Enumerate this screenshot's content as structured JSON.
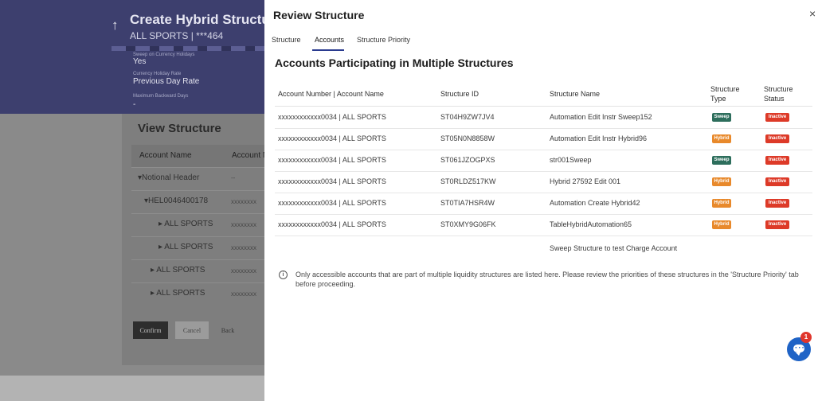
{
  "background": {
    "header": {
      "title": "Create Hybrid Structure",
      "subtitle": "ALL SPORTS | ***464",
      "fields": [
        {
          "label": "Sweep on Currency Holidays",
          "value": "Yes"
        },
        {
          "label": "Currency Holiday Rate",
          "value": "Previous Day Rate"
        },
        {
          "label": "Maximum Backward Days",
          "value": "-"
        }
      ]
    },
    "view_structure": {
      "title": "View Structure",
      "columns": [
        "Account Name",
        "Account N"
      ],
      "rows": [
        {
          "name": "▾Notional Header",
          "account": "--"
        },
        {
          "name": "▾HEL0046400178",
          "account": "xxxxxxxx"
        },
        {
          "name": "▸ ALL SPORTS",
          "account": "xxxxxxxx"
        },
        {
          "name": "▸ ALL SPORTS",
          "account": "xxxxxxxx"
        },
        {
          "name": "▸ ALL SPORTS",
          "account": "xxxxxxxx"
        },
        {
          "name": "▸ ALL SPORTS",
          "account": "xxxxxxxx"
        }
      ]
    },
    "buttons": {
      "confirm": "Confirm",
      "cancel": "Cancel",
      "back": "Back"
    }
  },
  "modal": {
    "title": "Review Structure",
    "close": "×",
    "tabs": [
      {
        "label": "Structure",
        "active": false
      },
      {
        "label": "Accounts",
        "active": true
      },
      {
        "label": "Structure Priority",
        "active": false
      }
    ],
    "heading": "Accounts Participating in Multiple Structures",
    "columns": {
      "account": "Account Number | Account Name",
      "id": "Structure ID",
      "name": "Structure Name",
      "type_line1": "Structure",
      "type_line2": "Type",
      "status_line1": "Structure",
      "status_line2": "Status"
    },
    "rows": [
      {
        "account": "xxxxxxxxxxxx0034 | ALL SPORTS",
        "id": "ST04H9ZW7JV4",
        "name": "Automation Edit Instr Sweep152",
        "type": "Sweep",
        "status": "Inactive"
      },
      {
        "account": "xxxxxxxxxxxx0034 | ALL SPORTS",
        "id": "ST05N0N8858W",
        "name": "Automation Edit Instr Hybrid96",
        "type": "Hybrid",
        "status": "Inactive"
      },
      {
        "account": "xxxxxxxxxxxx0034 | ALL SPORTS",
        "id": "ST061JZOGPXS",
        "name": "str001Sweep",
        "type": "Sweep",
        "status": "Inactive"
      },
      {
        "account": "xxxxxxxxxxxx0034 | ALL SPORTS",
        "id": "ST0RLDZ517KW",
        "name": "Hybrid 27592 Edit 001",
        "type": "Hybrid",
        "status": "Inactive"
      },
      {
        "account": "xxxxxxxxxxxx0034 | ALL SPORTS",
        "id": "ST0TIA7HSR4W",
        "name": "Automation Create Hybrid42",
        "type": "Hybrid",
        "status": "Inactive"
      },
      {
        "account": "xxxxxxxxxxxx0034 | ALL SPORTS",
        "id": "ST0XMY9G06FK",
        "name": "TableHybridAutomation65",
        "type": "Hybrid",
        "status": "Inactive"
      }
    ],
    "extra_row": {
      "name": "Sweep Structure to test Charge Account"
    },
    "info": "Only accessible accounts that are part of multiple liquidity structures are listed here. Please review the priorities of these structures in the 'Structure Priority' tab before proceeding."
  },
  "chat": {
    "count": "1"
  },
  "colors": {
    "sweep": "#2d6e5c",
    "hybrid": "#e8892b",
    "inactive": "#dd3a28",
    "accent": "#2a3b8f"
  }
}
